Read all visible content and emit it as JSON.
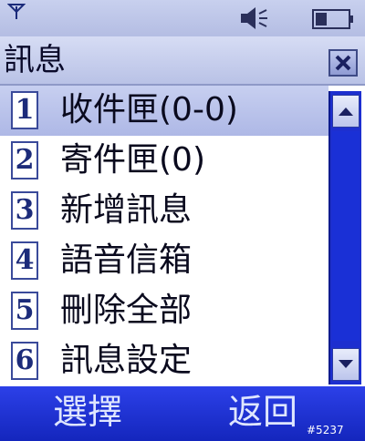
{
  "status_bar": {
    "icons": [
      "signal-icon",
      "speaker-icon",
      "battery-icon"
    ]
  },
  "title_bar": {
    "title": "訊息",
    "close_icon": "close-icon"
  },
  "menu": {
    "selected_index": 0,
    "items": [
      {
        "number": "1",
        "label": "收件匣(0-0)"
      },
      {
        "number": "2",
        "label": "寄件匣(0)"
      },
      {
        "number": "3",
        "label": "新增訊息"
      },
      {
        "number": "4",
        "label": "語音信箱"
      },
      {
        "number": "5",
        "label": "刪除全部"
      },
      {
        "number": "6",
        "label": "訊息設定"
      }
    ]
  },
  "softkeys": {
    "left": "選擇",
    "right": "返回"
  },
  "watermark": "#5237",
  "colors": {
    "softkey_bar": "#1d30d4",
    "selection": "#b8c1ea",
    "scrollbar": "#1d2fcf"
  }
}
